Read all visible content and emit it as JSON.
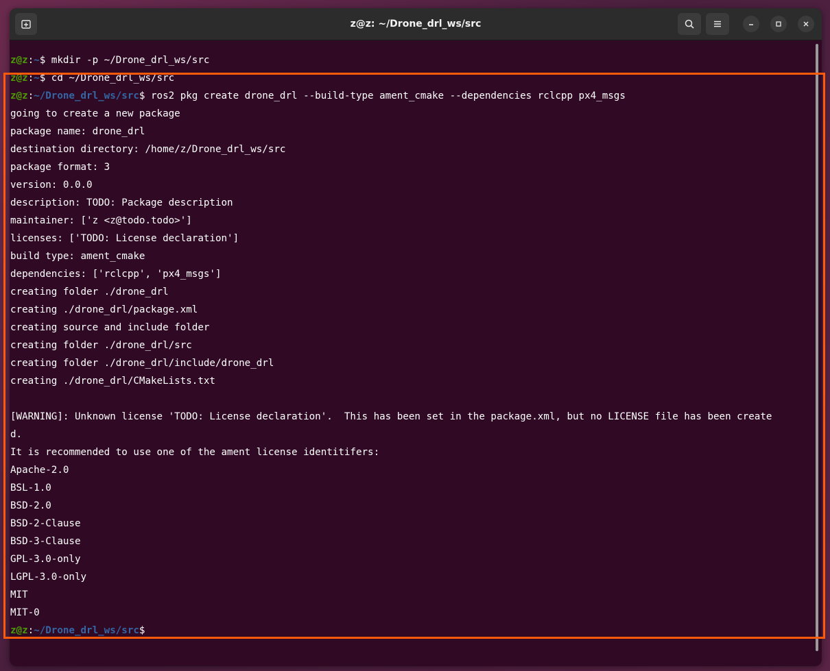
{
  "window": {
    "title": "z@z: ~/Drone_drl_ws/src"
  },
  "titlebar": {
    "icons": [
      "new-tab-icon",
      "search-icon",
      "hamburger-menu-icon",
      "minimize-icon",
      "maximize-icon",
      "close-icon"
    ]
  },
  "terminal": {
    "colors": {
      "background": "#300a24",
      "user": "#4e9a06",
      "path": "#3465a4",
      "text": "#ffffff"
    },
    "lines": [
      {
        "user": "z@z",
        "sep": ":",
        "path": "~",
        "cmd": "$ mkdir -p ~/Drone_drl_ws/src"
      },
      {
        "user": "z@z",
        "sep": ":",
        "path": "~",
        "cmd": "$ cd ~/Drone_drl_ws/src"
      },
      {
        "user": "z@z",
        "sep": ":",
        "path": "~/Drone_drl_ws/src",
        "cmd": "$ ros2 pkg create drone_drl --build-type ament_cmake --dependencies rclcpp px4_msgs"
      },
      {
        "text": "going to create a new package"
      },
      {
        "text": "package name: drone_drl"
      },
      {
        "text": "destination directory: /home/z/Drone_drl_ws/src"
      },
      {
        "text": "package format: 3"
      },
      {
        "text": "version: 0.0.0"
      },
      {
        "text": "description: TODO: Package description"
      },
      {
        "text": "maintainer: ['z <z@todo.todo>']"
      },
      {
        "text": "licenses: ['TODO: License declaration']"
      },
      {
        "text": "build type: ament_cmake"
      },
      {
        "text": "dependencies: ['rclcpp', 'px4_msgs']"
      },
      {
        "text": "creating folder ./drone_drl"
      },
      {
        "text": "creating ./drone_drl/package.xml"
      },
      {
        "text": "creating source and include folder"
      },
      {
        "text": "creating folder ./drone_drl/src"
      },
      {
        "text": "creating folder ./drone_drl/include/drone_drl"
      },
      {
        "text": "creating ./drone_drl/CMakeLists.txt"
      },
      {
        "text": ""
      },
      {
        "text": "[WARNING]: Unknown license 'TODO: License declaration'.  This has been set in the package.xml, but no LICENSE file has been create"
      },
      {
        "text": "d."
      },
      {
        "text": "It is recommended to use one of the ament license identitifers:"
      },
      {
        "text": "Apache-2.0"
      },
      {
        "text": "BSL-1.0"
      },
      {
        "text": "BSD-2.0"
      },
      {
        "text": "BSD-2-Clause"
      },
      {
        "text": "BSD-3-Clause"
      },
      {
        "text": "GPL-3.0-only"
      },
      {
        "text": "LGPL-3.0-only"
      },
      {
        "text": "MIT"
      },
      {
        "text": "MIT-0"
      },
      {
        "user": "z@z",
        "sep": ":",
        "path": "~/Drone_drl_ws/src",
        "cmd": "$"
      }
    ]
  },
  "highlight": {
    "color": "#ff5a0a"
  }
}
